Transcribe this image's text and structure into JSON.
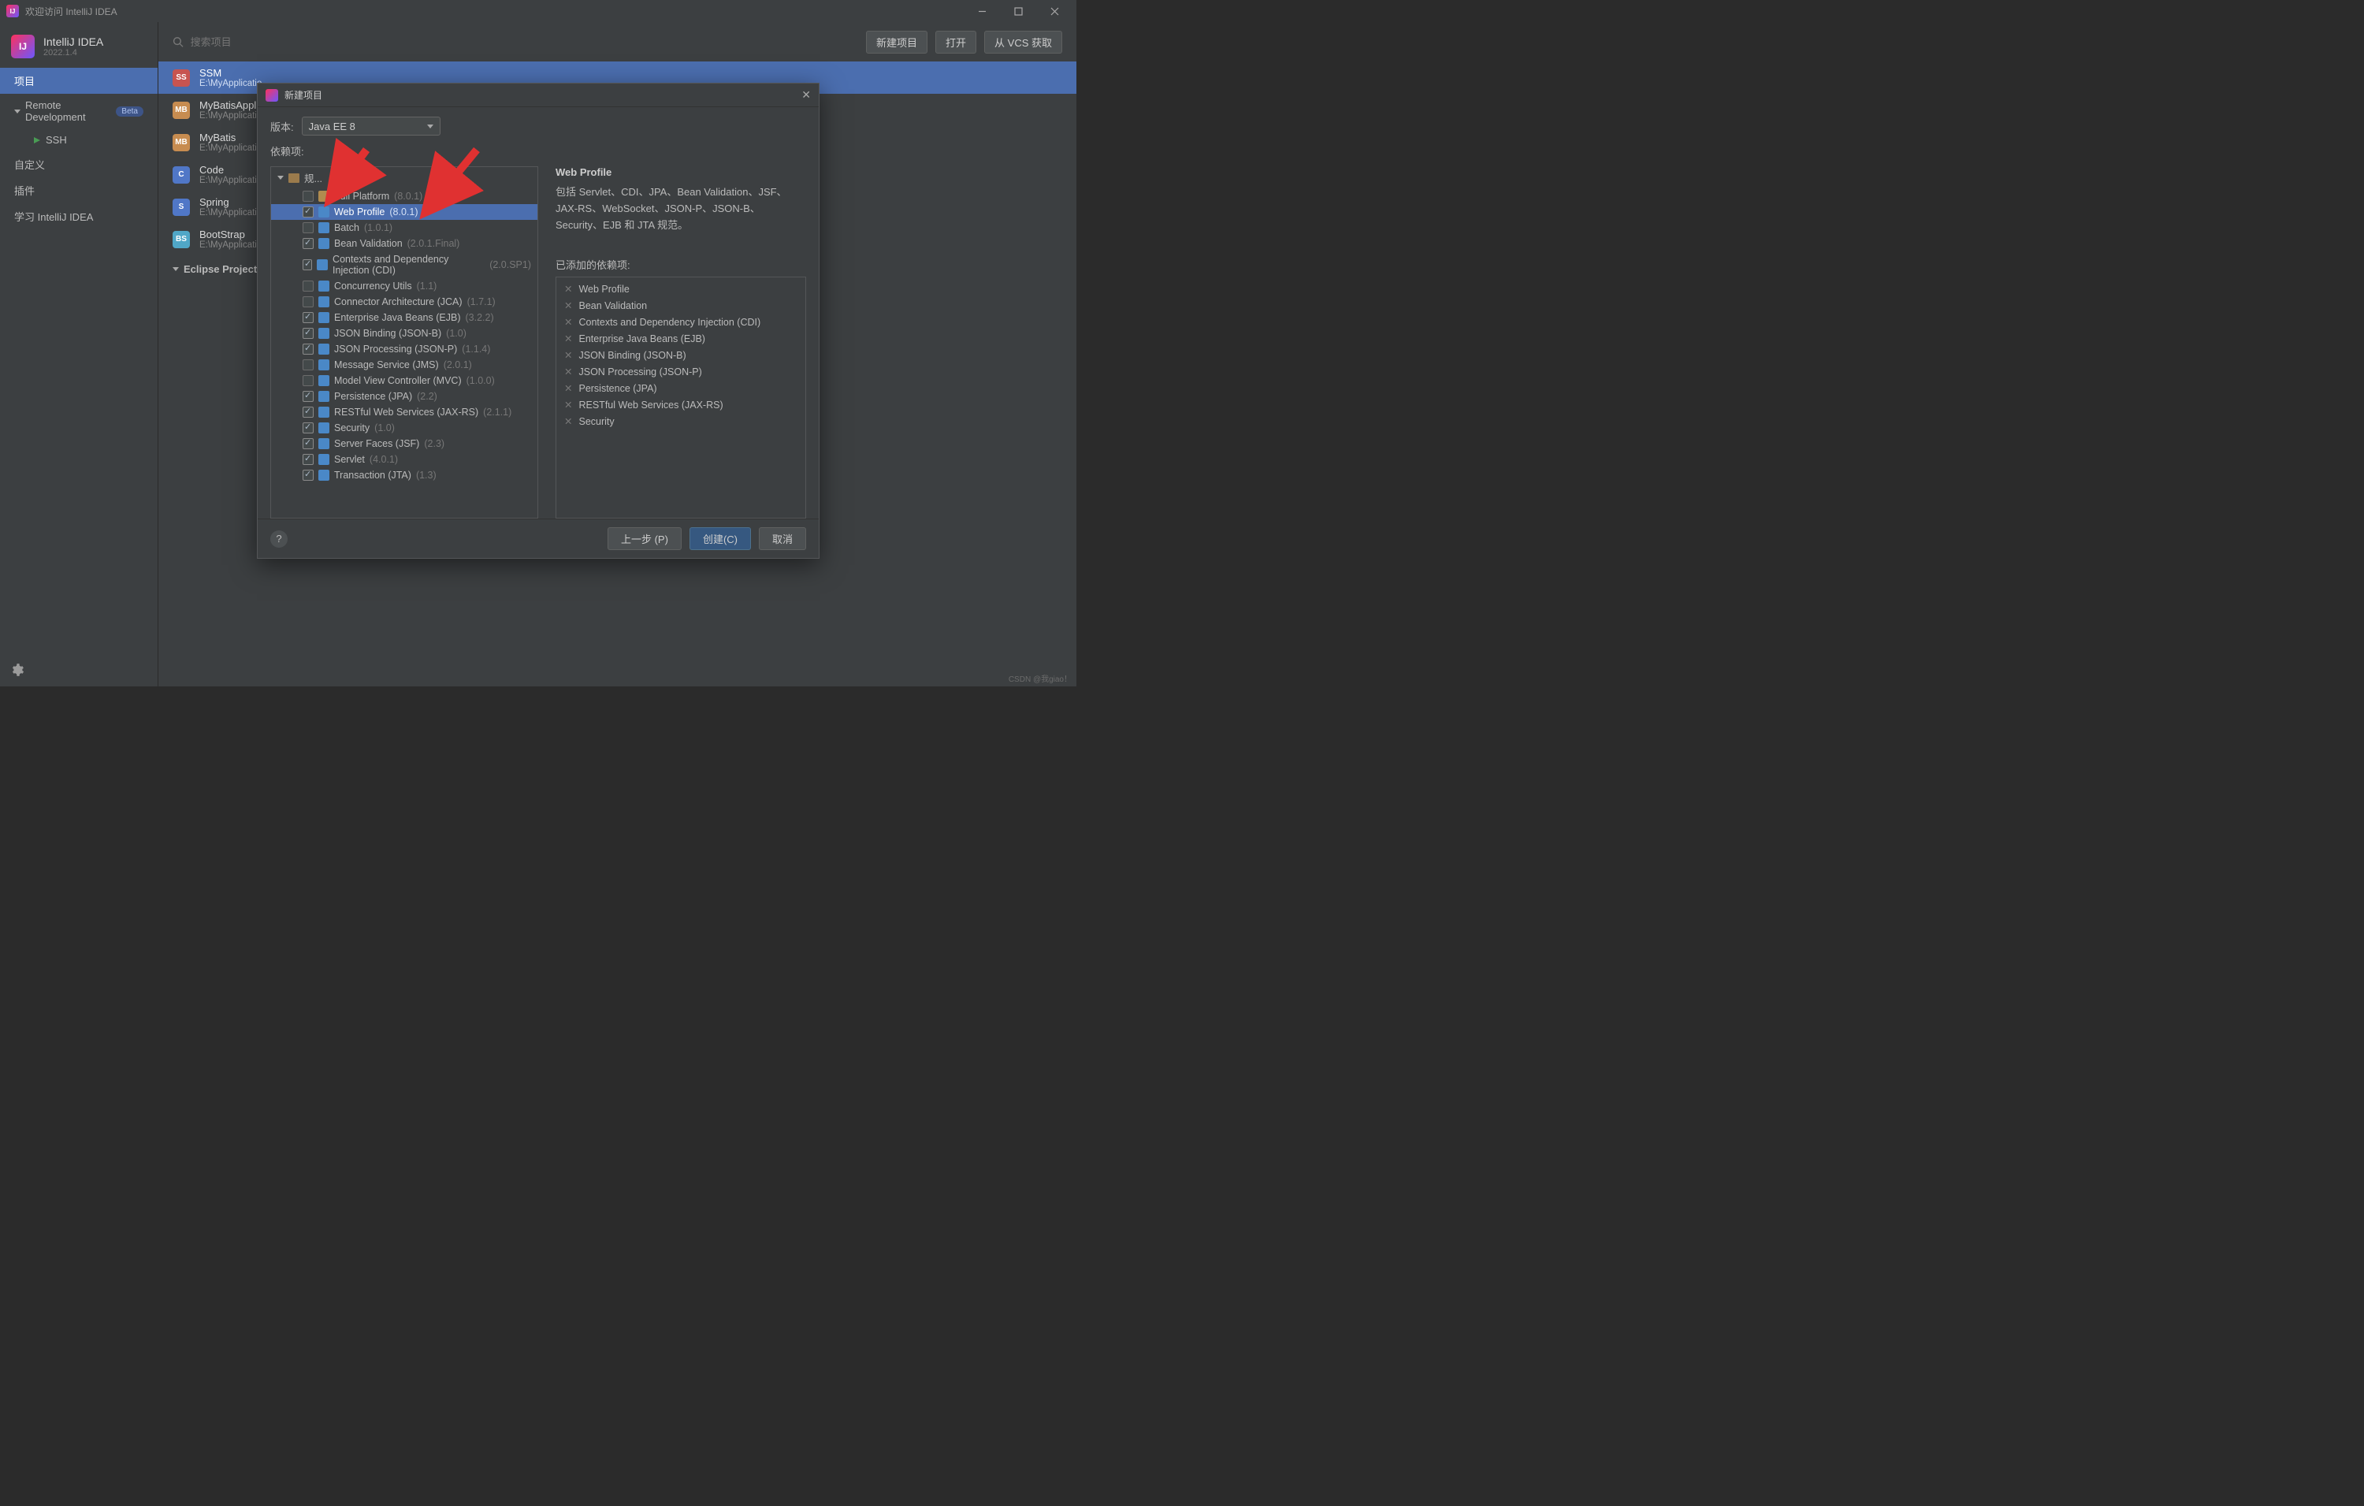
{
  "window": {
    "title": "欢迎访问 IntelliJ IDEA"
  },
  "brand": {
    "name": "IntelliJ IDEA",
    "version": "2022.1.4"
  },
  "sidebar": {
    "items": [
      {
        "label": "项目",
        "selected": true
      },
      {
        "label": "Remote Development",
        "beta": "Beta",
        "expandable": true
      },
      {
        "label": "SSH",
        "sub": true
      },
      {
        "label": "自定义"
      },
      {
        "label": "插件"
      },
      {
        "label": "学习 IntelliJ IDEA"
      }
    ]
  },
  "topbar": {
    "search_placeholder": "搜索项目",
    "buttons": {
      "new": "新建项目",
      "open": "打开",
      "vcs": "从 VCS 获取"
    }
  },
  "projects": [
    {
      "name": "SSM",
      "path": "E:\\MyApplicatio...",
      "avatar_bg": "#c75450",
      "avatar": "SS"
    },
    {
      "name": "MyBatisApplicatio...",
      "path": "E:\\MyApplicatio...",
      "avatar_bg": "#c78c50",
      "avatar": "MB"
    },
    {
      "name": "MyBatis",
      "path": "E:\\MyApplicatio...",
      "avatar_bg": "#c78c50",
      "avatar": "MB"
    },
    {
      "name": "Code",
      "path": "E:\\MyApplicatio...",
      "avatar_bg": "#5077c7",
      "avatar": "C"
    },
    {
      "name": "Spring",
      "path": "E:\\MyApplicatio...",
      "avatar_bg": "#5077c7",
      "avatar": "S"
    },
    {
      "name": "BootStrap",
      "path": "E:\\MyApplicatio...",
      "avatar_bg": "#50a7c7",
      "avatar": "BS"
    }
  ],
  "project_section": "Eclipse Projects",
  "dialog": {
    "title": "新建项目",
    "version_label": "版本:",
    "version_value": "Java EE 8",
    "deps_label": "依赖项:",
    "spec_group": "规...",
    "description_title": "Web Profile",
    "description_body": "包括 Servlet、CDI、JPA、Bean Validation、JSF、JAX-RS、WebSocket、JSON-P、JSON-B、Security、EJB 和 JTA 规范。",
    "deps": [
      {
        "name": "Full Platform",
        "ver": "(8.0.1)",
        "checked": false,
        "stack": true
      },
      {
        "name": "Web Profile",
        "ver": "(8.0.1)",
        "checked": true,
        "selected": true
      },
      {
        "name": "Batch",
        "ver": "(1.0.1)",
        "checked": false
      },
      {
        "name": "Bean Validation",
        "ver": "(2.0.1.Final)",
        "checked": true
      },
      {
        "name": "Contexts and Dependency Injection (CDI)",
        "ver": "(2.0.SP1)",
        "checked": true
      },
      {
        "name": "Concurrency Utils",
        "ver": "(1.1)",
        "checked": false
      },
      {
        "name": "Connector Architecture (JCA)",
        "ver": "(1.7.1)",
        "checked": false
      },
      {
        "name": "Enterprise Java Beans (EJB)",
        "ver": "(3.2.2)",
        "checked": true
      },
      {
        "name": "JSON Binding (JSON-B)",
        "ver": "(1.0)",
        "checked": true
      },
      {
        "name": "JSON Processing (JSON-P)",
        "ver": "(1.1.4)",
        "checked": true
      },
      {
        "name": "Message Service (JMS)",
        "ver": "(2.0.1)",
        "checked": false
      },
      {
        "name": "Model View Controller (MVC)",
        "ver": "(1.0.0)",
        "checked": false
      },
      {
        "name": "Persistence (JPA)",
        "ver": "(2.2)",
        "checked": true
      },
      {
        "name": "RESTful Web Services (JAX-RS)",
        "ver": "(2.1.1)",
        "checked": true
      },
      {
        "name": "Security",
        "ver": "(1.0)",
        "checked": true
      },
      {
        "name": "Server Faces (JSF)",
        "ver": "(2.3)",
        "checked": true
      },
      {
        "name": "Servlet",
        "ver": "(4.0.1)",
        "checked": true
      },
      {
        "name": "Transaction (JTA)",
        "ver": "(1.3)",
        "checked": true
      }
    ],
    "added_label": "已添加的依赖项:",
    "added": [
      "Web Profile",
      "Bean Validation",
      "Contexts and Dependency Injection (CDI)",
      "Enterprise Java Beans (EJB)",
      "JSON Binding (JSON-B)",
      "JSON Processing (JSON-P)",
      "Persistence (JPA)",
      "RESTful Web Services (JAX-RS)",
      "Security"
    ],
    "buttons": {
      "prev": "上一步 (P)",
      "create": "创建(C)",
      "cancel": "取消"
    }
  },
  "watermark": "CSDN @我giao！"
}
